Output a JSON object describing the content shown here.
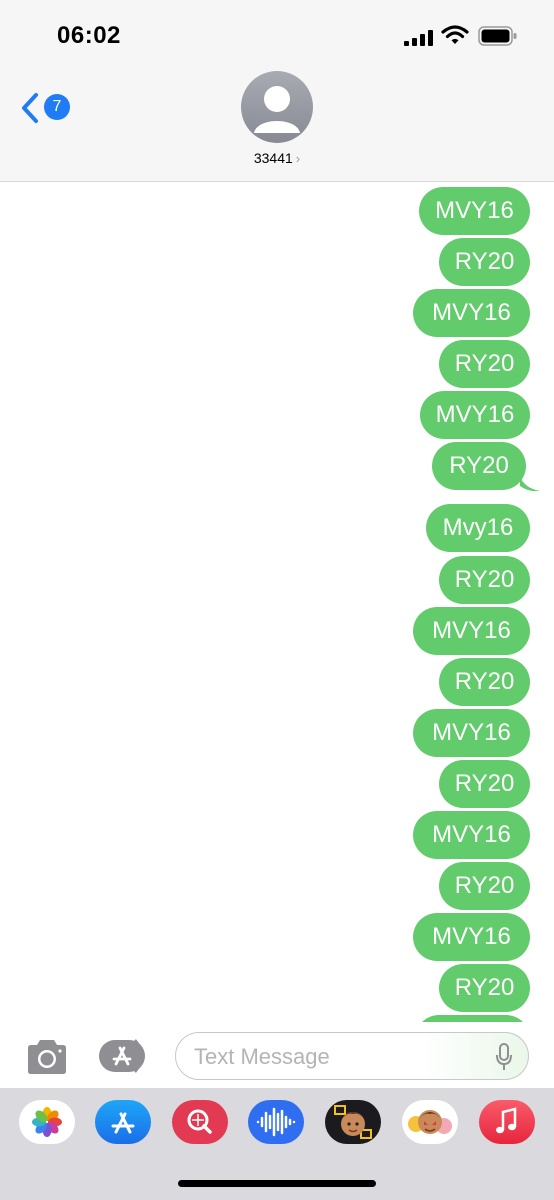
{
  "status_bar": {
    "time": "06:02"
  },
  "header": {
    "back_badge": "7",
    "contact_name": "33441",
    "chevron": "›"
  },
  "messages": [
    "MVY16",
    "RY20",
    "MVY16",
    "RY20",
    "MVY16",
    "RY20",
    "Mvy16",
    "RY20",
    "MVY16",
    "RY20",
    "MVY16",
    "RY20",
    "MVY16",
    "RY20",
    "MVY16",
    "RY20",
    ""
  ],
  "input": {
    "placeholder": "Text Message"
  },
  "app_drawer": {
    "apps": [
      "photos-app-icon",
      "app-store-icon",
      "web-image-search-icon",
      "audio-message-icon",
      "memoji-icon",
      "memoji-stickers-icon",
      "music-icon"
    ]
  },
  "colors": {
    "bubble": "#62cb6b",
    "badge": "#1f7cf5",
    "header_bg": "#f6f6f6"
  }
}
